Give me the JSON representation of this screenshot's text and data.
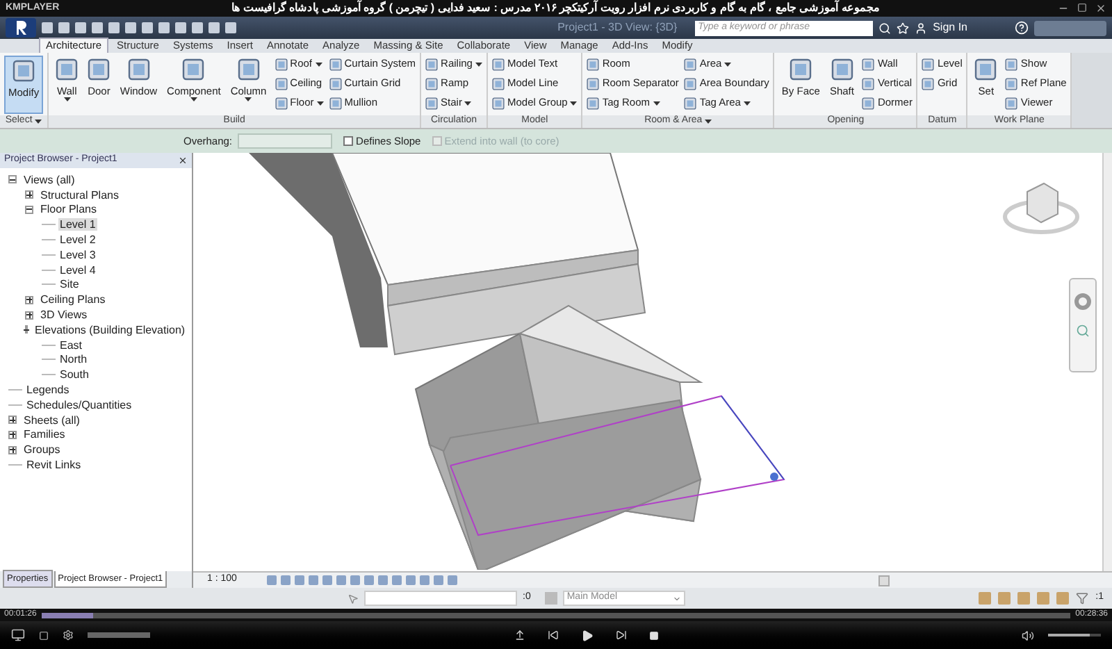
{
  "player": {
    "logo": "KMPLAYER",
    "title": "مجموعه آموزشی جامع ، گام به گام و کاربردی نرم افزار رویت آرکیتکچر ۲۰۱۶ مدرس : سعید فدایی ( تیچرمن ) گروه آموزشی پادشاه گرافیست ها",
    "elapsed": "00:01:26",
    "total": "00:28:36",
    "seek": {
      "level": 0.05
    },
    "volume": {
      "level": 0.8
    }
  },
  "app": {
    "window_title": "Project1 - 3D View: {3D}",
    "search": {
      "placeholder": "Type a keyword or phrase"
    },
    "sign_in": "Sign In"
  },
  "tabs": [
    {
      "label": "Architecture",
      "selected": true
    },
    {
      "label": "Structure",
      "selected": false
    },
    {
      "label": "Systems",
      "selected": false
    },
    {
      "label": "Insert",
      "selected": false
    },
    {
      "label": "Annotate",
      "selected": false
    },
    {
      "label": "Analyze",
      "selected": false
    },
    {
      "label": "Massing & Site",
      "selected": false
    },
    {
      "label": "Collaborate",
      "selected": false
    },
    {
      "label": "View",
      "selected": false
    },
    {
      "label": "Manage",
      "selected": false
    },
    {
      "label": "Add-Ins",
      "selected": false
    },
    {
      "label": "Modify",
      "selected": false
    }
  ],
  "ribbon": [
    {
      "title": "Select",
      "dropdown": true,
      "groups": [
        {
          "kind": "large",
          "items": [
            {
              "label": "Modify",
              "selected": true,
              "dropdown": false
            }
          ]
        }
      ]
    },
    {
      "title": "Build",
      "dropdown": false,
      "groups": [
        {
          "kind": "large",
          "items": [
            {
              "label": "Wall",
              "selected": false,
              "dropdown": true
            },
            {
              "label": "Door",
              "selected": false,
              "dropdown": false
            },
            {
              "label": "Window",
              "selected": false,
              "dropdown": false
            },
            {
              "label": "Component",
              "selected": false,
              "dropdown": true
            },
            {
              "label": "Column",
              "selected": false,
              "dropdown": true
            }
          ]
        },
        {
          "kind": "stack",
          "items": [
            {
              "label": "Roof",
              "selected": false,
              "dropdown": true
            },
            {
              "label": "Ceiling",
              "selected": false,
              "dropdown": false
            },
            {
              "label": "Floor",
              "selected": false,
              "dropdown": true
            }
          ]
        },
        {
          "kind": "stack",
          "items": [
            {
              "label": "Curtain System",
              "selected": false,
              "dropdown": false
            },
            {
              "label": "Curtain Grid",
              "selected": false,
              "dropdown": false
            },
            {
              "label": "Mullion",
              "selected": false,
              "dropdown": false
            }
          ]
        }
      ]
    },
    {
      "title": "Circulation",
      "dropdown": false,
      "groups": [
        {
          "kind": "stack",
          "items": [
            {
              "label": "Railing",
              "selected": false,
              "dropdown": true
            },
            {
              "label": "Ramp",
              "selected": false,
              "dropdown": false
            },
            {
              "label": "Stair",
              "selected": false,
              "dropdown": true
            }
          ]
        }
      ]
    },
    {
      "title": "Model",
      "dropdown": false,
      "groups": [
        {
          "kind": "stack",
          "items": [
            {
              "label": "Model Text",
              "selected": false,
              "dropdown": false
            },
            {
              "label": "Model Line",
              "selected": false,
              "dropdown": false
            },
            {
              "label": "Model Group",
              "selected": false,
              "dropdown": true
            }
          ]
        }
      ]
    },
    {
      "title": "Room & Area",
      "dropdown": true,
      "groups": [
        {
          "kind": "stack",
          "items": [
            {
              "label": "Room",
              "selected": false,
              "dropdown": false
            },
            {
              "label": "Room Separator",
              "selected": false,
              "dropdown": false
            },
            {
              "label": "Tag Room",
              "selected": false,
              "dropdown": true
            }
          ]
        },
        {
          "kind": "stack",
          "items": [
            {
              "label": "Area",
              "selected": false,
              "dropdown": true
            },
            {
              "label": "Area Boundary",
              "selected": false,
              "dropdown": false
            },
            {
              "label": "Tag Area",
              "selected": false,
              "dropdown": true
            }
          ]
        }
      ]
    },
    {
      "title": "Opening",
      "dropdown": false,
      "groups": [
        {
          "kind": "large",
          "items": [
            {
              "label": "By Face",
              "selected": false,
              "dropdown": false
            },
            {
              "label": "Shaft",
              "selected": false,
              "dropdown": false
            }
          ]
        },
        {
          "kind": "stack",
          "items": [
            {
              "label": "Wall",
              "selected": false,
              "dropdown": false
            },
            {
              "label": "Vertical",
              "selected": false,
              "dropdown": false
            },
            {
              "label": "Dormer",
              "selected": false,
              "dropdown": false
            }
          ]
        }
      ]
    },
    {
      "title": "Datum",
      "dropdown": false,
      "groups": [
        {
          "kind": "stack",
          "items": [
            {
              "label": "Level",
              "selected": false,
              "dropdown": false
            },
            {
              "label": "Grid",
              "selected": false,
              "dropdown": false
            }
          ]
        }
      ]
    },
    {
      "title": "Work Plane",
      "dropdown": false,
      "groups": [
        {
          "kind": "large",
          "items": [
            {
              "label": "Set",
              "selected": false,
              "dropdown": false
            }
          ]
        },
        {
          "kind": "stack",
          "items": [
            {
              "label": "Show",
              "selected": false,
              "dropdown": false
            },
            {
              "label": "Ref Plane",
              "selected": false,
              "dropdown": false
            },
            {
              "label": "Viewer",
              "selected": false,
              "dropdown": false
            }
          ]
        }
      ]
    }
  ],
  "options_bar": {
    "overhang_label": "Overhang:",
    "checkboxes": [
      {
        "label": "Defines Slope",
        "checked": false,
        "disabled": false
      },
      {
        "label": "Extend into wall (to core)",
        "checked": false,
        "disabled": true
      }
    ]
  },
  "project_browser": {
    "title": "Project Browser - Project1",
    "tree": [
      {
        "label": "Views (all)",
        "expanded": true,
        "selected": false,
        "children": [
          {
            "label": "Structural Plans",
            "expanded": false,
            "selected": false
          },
          {
            "label": "Floor Plans",
            "expanded": true,
            "selected": false,
            "children": [
              {
                "label": "Level 1",
                "selected": true
              },
              {
                "label": "Level 2",
                "selected": false
              },
              {
                "label": "Level 3",
                "selected": false
              },
              {
                "label": "Level 4",
                "selected": false
              },
              {
                "label": "Site",
                "selected": false
              }
            ]
          },
          {
            "label": "Ceiling Plans",
            "expanded": false,
            "selected": false
          },
          {
            "label": "3D Views",
            "expanded": false,
            "selected": false
          },
          {
            "label": "Elevations (Building Elevation)",
            "expanded": true,
            "selected": false,
            "children": [
              {
                "label": "East",
                "selected": false
              },
              {
                "label": "North",
                "selected": false
              },
              {
                "label": "South",
                "selected": false
              }
            ]
          }
        ]
      },
      {
        "label": "Legends",
        "selected": false
      },
      {
        "label": "Schedules/Quantities",
        "selected": false
      },
      {
        "label": "Sheets (all)",
        "expanded": false,
        "selected": false
      },
      {
        "label": "Families",
        "expanded": false,
        "selected": false
      },
      {
        "label": "Groups",
        "expanded": false,
        "selected": false
      },
      {
        "label": "Revit Links",
        "selected": false
      }
    ]
  },
  "panel_tabs": [
    {
      "label": "Properties",
      "selected": false
    },
    {
      "label": "Project Browser - Project1",
      "selected": true
    }
  ],
  "view_bar": {
    "scale": "1 : 100"
  },
  "status_bar": {
    "workset_count": ":0",
    "model": "Main Model",
    "filter_count": ":1"
  }
}
